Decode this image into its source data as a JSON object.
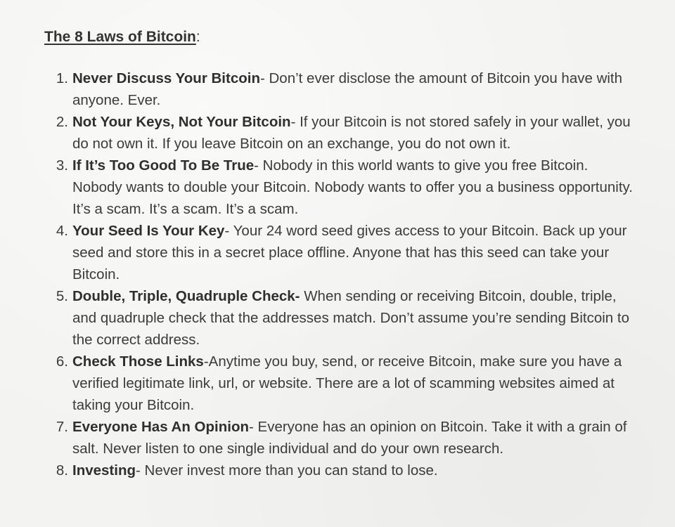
{
  "header": {
    "title": "The 8 Laws of Bitcoin",
    "title_suffix": ":"
  },
  "laws": [
    {
      "number": "1.",
      "title": "Never Discuss Your Bitcoin",
      "text": "- Don’t ever disclose the amount of Bitcoin you have with anyone. Ever."
    },
    {
      "number": "2.",
      "title": "Not Your Keys, Not Your Bitcoin",
      "text": "- If your Bitcoin is not stored safely in your wallet, you do not own it. If you leave Bitcoin on an exchange, you do not own it."
    },
    {
      "number": "3.",
      "title": "If It’s Too Good To Be True",
      "text": "- Nobody in this world wants to give you free Bitcoin. Nobody wants to double your Bitcoin. Nobody wants to offer you a business opportunity. It’s a scam. It’s a scam. It’s a scam."
    },
    {
      "number": "4.",
      "title": "Your Seed Is Your Key",
      "text": "- Your 24 word seed gives access to your Bitcoin. Back up your seed and store this in a secret place offline. Anyone that has this seed can take your Bitcoin."
    },
    {
      "number": "5.",
      "title": "Double, Triple, Quadruple Check-",
      "text": " When sending or receiving Bitcoin, double, triple, and quadruple check that the addresses match. Don’t assume you’re sending Bitcoin to the correct address."
    },
    {
      "number": "6.",
      "title": "Check Those Links",
      "text": "-Anytime you buy, send, or receive Bitcoin, make sure you have a verified legitimate link, url, or website. There are a lot of scamming websites aimed at taking your Bitcoin."
    },
    {
      "number": "7.",
      "title": "Everyone Has An Opinion",
      "text": "- Everyone has an opinion on Bitcoin. Take it with a grain of salt. Never listen to one single individual and do your own research."
    },
    {
      "number": "8.",
      "title": "Investing",
      "text": "- Never invest more than you can stand to lose."
    }
  ]
}
